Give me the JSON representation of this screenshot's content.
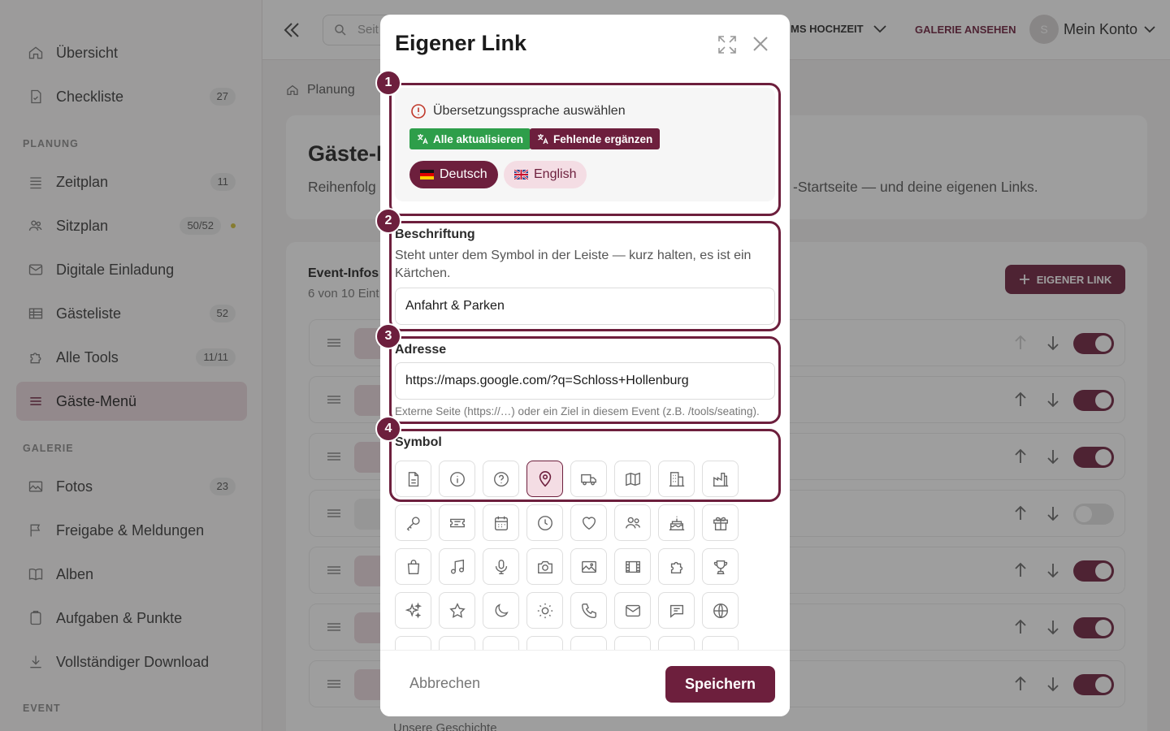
{
  "sidebar": {
    "items": [
      {
        "label": "Übersicht",
        "count": "",
        "icon": "home-icon"
      },
      {
        "label": "Checkliste",
        "count": "27",
        "icon": "checklist-icon"
      },
      {
        "label": "Zeitplan",
        "count": "11",
        "icon": "schedule-icon"
      },
      {
        "label": "Sitzplan",
        "count": "50/52",
        "icon": "users-icon"
      },
      {
        "label": "Digitale Einladung",
        "count": "",
        "icon": "mail-icon"
      },
      {
        "label": "Gästeliste",
        "count": "52",
        "icon": "table-icon"
      },
      {
        "label": "Alle Tools",
        "count": "11/11",
        "icon": "puzzle-icon"
      },
      {
        "label": "Gäste-Menü",
        "count": "",
        "icon": "menu-icon"
      },
      {
        "label": "Fotos",
        "count": "23",
        "icon": "photo-icon"
      },
      {
        "label": "Freigabe & Meldungen",
        "count": "",
        "icon": "flag-icon"
      },
      {
        "label": "Alben",
        "count": "",
        "icon": "book-icon"
      },
      {
        "label": "Aufgaben & Punkte",
        "count": "",
        "icon": "clipboard-icon"
      },
      {
        "label": "Vollständiger Download",
        "count": "",
        "icon": "download-icon"
      }
    ],
    "sections": {
      "planung": "PLANUNG",
      "galerie": "GALERIE",
      "event": "EVENT"
    }
  },
  "topbar": {
    "search_placeholder": "Seit",
    "event_name": "MS HOCHZEIT",
    "gallery_link": "GALERIE ANSEHEN",
    "avatar_initial": "S",
    "account_label": "Mein Konto"
  },
  "breadcrumb": {
    "item": "Planung"
  },
  "page": {
    "title": "Gäste-M",
    "desc_left": "Reihenfolg",
    "desc_right": "-Startseite — und deine eigenen Links.",
    "list_title": "Event-Infos &",
    "list_sub": "6 von 10 Eint",
    "add_button": "EIGENER LINK",
    "bottom_row": "Unsere Geschichte"
  },
  "modal": {
    "title": "Eigener Link",
    "translation": {
      "heading": "Übersetzungssprache auswählen",
      "update_all": "Alle aktualisieren",
      "fill_missing": "Fehlende ergänzen",
      "lang_de": "Deutsch",
      "lang_en": "English"
    },
    "label_field": {
      "label": "Beschriftung",
      "help": "Steht unter dem Symbol in der Leiste — kurz halten, es ist ein Kärtchen.",
      "value": "Anfahrt & Parken"
    },
    "address_field": {
      "label": "Adresse",
      "value": "https://maps.google.com/?q=Schloss+Hollenburg",
      "hint": "Externe Seite (https://…) oder ein Ziel in diesem Event (z.B. /tools/seating)."
    },
    "symbol_field": {
      "label": "Symbol"
    },
    "icons": [
      "document-icon",
      "info-icon",
      "question-icon",
      "map-pin-icon",
      "truck-icon",
      "map-icon",
      "building-icon",
      "factory-icon",
      "key-icon",
      "ticket-icon",
      "calendar-icon",
      "clock-icon",
      "heart-icon",
      "users-icon",
      "cake-icon",
      "gift-icon",
      "shopping-bag-icon",
      "music-icon",
      "microphone-icon",
      "camera-icon",
      "image-icon",
      "film-icon",
      "puzzle-icon",
      "trophy-icon",
      "sparkles-icon",
      "star-icon",
      "moon-icon",
      "sun-icon",
      "phone-icon",
      "mail-icon",
      "chat-icon",
      "globe-icon"
    ],
    "selected_icon": "map-pin-icon",
    "cancel": "Abbrechen",
    "save": "Speichern",
    "steps": [
      "1",
      "2",
      "3",
      "4"
    ]
  },
  "colors": {
    "accent": "#6d1f3d",
    "accent_light": "#f4dde4",
    "green": "#2e9e4a"
  }
}
